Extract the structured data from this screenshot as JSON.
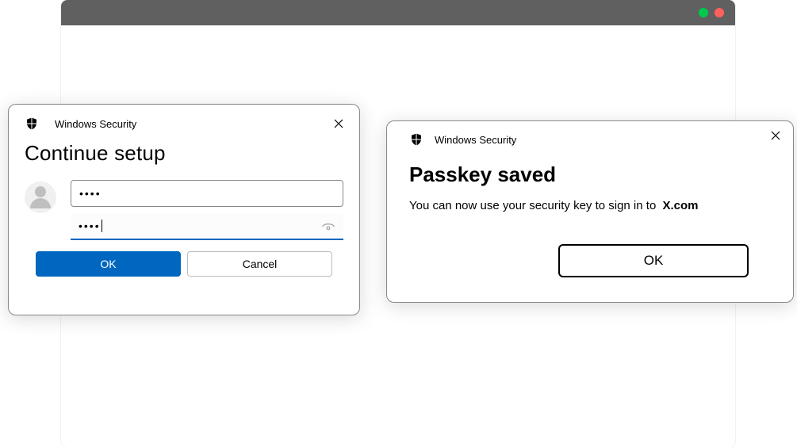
{
  "dialog_left": {
    "app_name": "Windows Security",
    "title": "Continue setup",
    "pin1": "••••",
    "pin2": "••••",
    "ok_label": "OK",
    "cancel_label": "Cancel"
  },
  "dialog_right": {
    "app_name": "Windows Security",
    "title": "Passkey saved",
    "desc_prefix": "You can now use your security key to sign in to",
    "site": "X.com",
    "ok_label": "OK"
  },
  "icons": {
    "shield": "shield-icon",
    "close": "close-icon",
    "avatar": "avatar-icon",
    "eye": "reveal-password-icon"
  },
  "colors": {
    "primary": "#0067c0",
    "titlebar": "#606060"
  }
}
